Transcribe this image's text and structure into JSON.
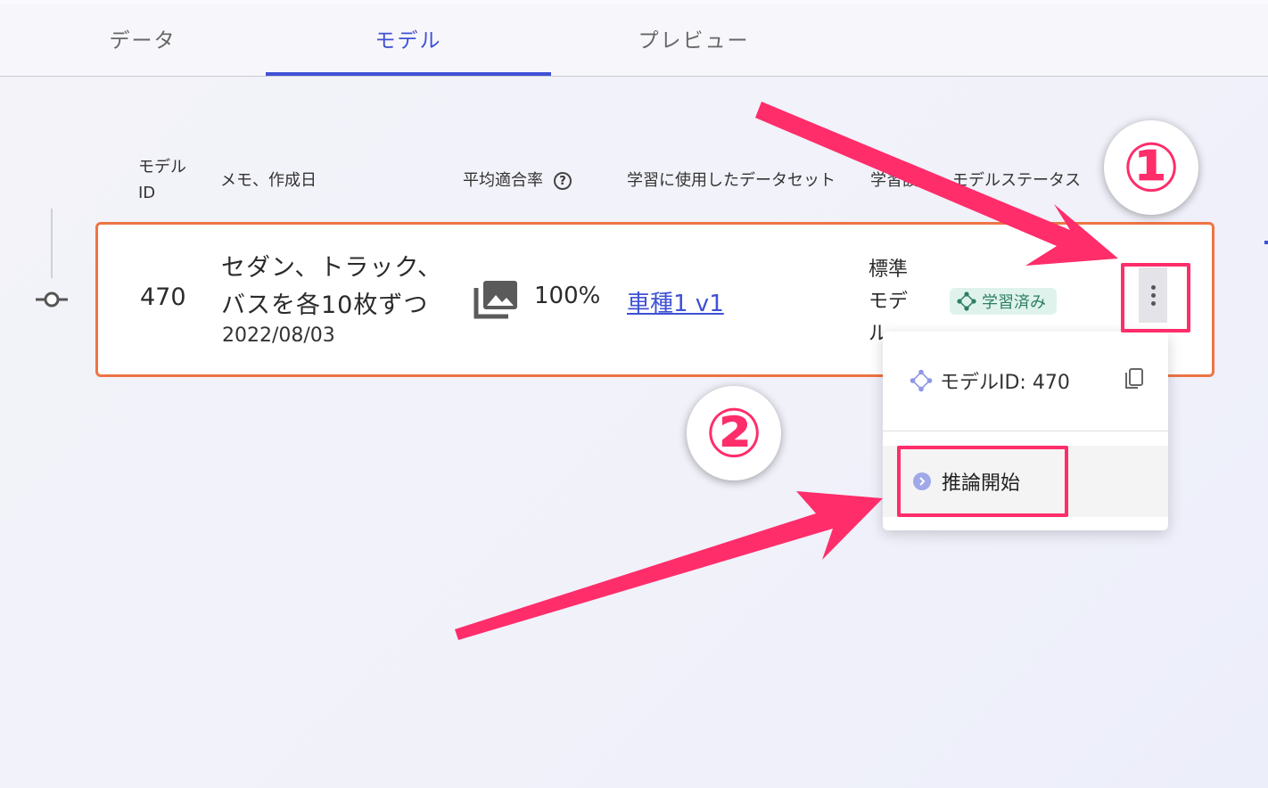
{
  "tabs": [
    {
      "label": "データ",
      "active": false
    },
    {
      "label": "モデル",
      "active": true
    },
    {
      "label": "プレビュー",
      "active": false
    }
  ],
  "table": {
    "headers": {
      "model_id": "モデル\nID",
      "memo": "メモ、作成日",
      "accuracy": "平均適合率",
      "dataset": "学習に使用したデータセット",
      "method": "学習設",
      "status": "モデルステータス"
    },
    "help_icon": "?",
    "row": {
      "model_id": "470",
      "memo_line1": "セダン、トラック、",
      "memo_line2": "バスを各10枚ずつ",
      "date": "2022/08/03",
      "accuracy": "100%",
      "dataset": "車種1 v1",
      "method": "標準モデル",
      "status": "学習済み"
    }
  },
  "menu": {
    "model_id_label": "モデルID: 470",
    "inference_label": "推論開始"
  },
  "annotations": {
    "step1": "①",
    "step2": "②",
    "color": "#ff2d6a"
  },
  "icons": [
    "timeline-node-icon",
    "photo-library-icon",
    "help-circle-icon",
    "model-diamond-icon",
    "more-vert-icon",
    "copy-icon",
    "chevron-right-icon"
  ],
  "colors": {
    "accent": "#3f51d5",
    "row_border": "#ee7443",
    "status_bg": "#dff3ec",
    "status_text": "#2e7d63"
  }
}
